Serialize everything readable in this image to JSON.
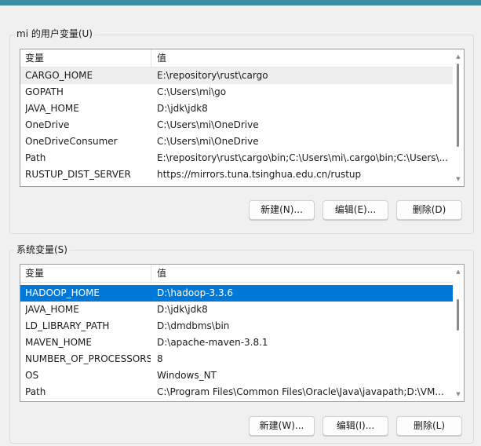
{
  "user_vars": {
    "label": "mi 的用户变量(U)",
    "columns": {
      "variable": "变量",
      "value": "值"
    },
    "rows": [
      {
        "name": "CARGO_HOME",
        "value": "E:\\repository\\rust\\cargo"
      },
      {
        "name": "GOPATH",
        "value": "C:\\Users\\mi\\go"
      },
      {
        "name": "JAVA_HOME",
        "value": "D:\\jdk\\jdk8"
      },
      {
        "name": "OneDrive",
        "value": "C:\\Users\\mi\\OneDrive"
      },
      {
        "name": "OneDriveConsumer",
        "value": "C:\\Users\\mi\\OneDrive"
      },
      {
        "name": "Path",
        "value": "E:\\repository\\rust\\cargo\\bin;C:\\Users\\mi\\.cargo\\bin;C:\\Users\\..."
      },
      {
        "name": "RUSTUP_DIST_SERVER",
        "value": "https://mirrors.tuna.tsinghua.edu.cn/rustup"
      }
    ],
    "buttons": {
      "new": "新建(N)...",
      "edit": "编辑(E)...",
      "delete": "删除(D)"
    }
  },
  "system_vars": {
    "label": "系统变量(S)",
    "columns": {
      "variable": "变量",
      "value": "值"
    },
    "rows": [
      {
        "name": "HADOOP_HOME",
        "value": "D:\\hadoop-3.3.6"
      },
      {
        "name": "JAVA_HOME",
        "value": "D:\\jdk\\jdk8"
      },
      {
        "name": "LD_LIBRARY_PATH",
        "value": "D:\\dmdbms\\bin"
      },
      {
        "name": "MAVEN_HOME",
        "value": "D:\\apache-maven-3.8.1"
      },
      {
        "name": "NUMBER_OF_PROCESSORS",
        "value": "8"
      },
      {
        "name": "OS",
        "value": "Windows_NT"
      },
      {
        "name": "Path",
        "value": "C:\\Program Files\\Common Files\\Oracle\\Java\\javapath;D:\\VM..."
      }
    ],
    "buttons": {
      "new": "新建(W)...",
      "edit": "编辑(I)...",
      "delete": "删除(L)"
    }
  },
  "colors": {
    "selection": "#0078d7",
    "title_strip": "#3d8ea3"
  },
  "icons": {
    "scroll_up": "scroll-up-arrow-icon",
    "scroll_down": "scroll-down-arrow-icon"
  }
}
